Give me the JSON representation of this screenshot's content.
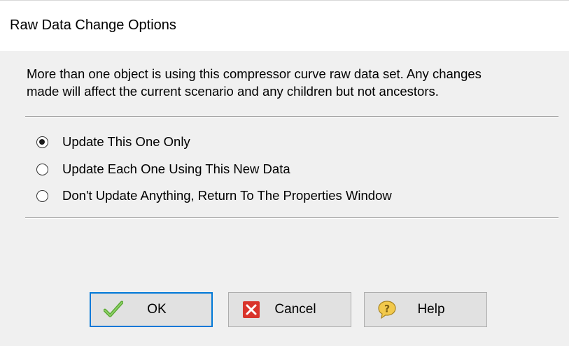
{
  "window": {
    "title": "Raw Data Change Options"
  },
  "description": {
    "line1": "More than one object is using this compressor curve raw data set. Any changes",
    "line2": "made will affect the current scenario and any children but not ancestors."
  },
  "options": [
    {
      "label": "Update This One Only",
      "selected": true
    },
    {
      "label": "Update Each One Using This New Data",
      "selected": false
    },
    {
      "label": "Don't Update Anything, Return To The Properties Window",
      "selected": false
    }
  ],
  "buttons": {
    "ok": {
      "label": "OK",
      "icon": "checkmark-icon",
      "color": "#5aa832"
    },
    "cancel": {
      "label": "Cancel",
      "icon": "close-icon",
      "color": "#d9342b"
    },
    "help": {
      "label": "Help",
      "icon": "help-icon",
      "color": "#f2c94c"
    }
  },
  "colors": {
    "focus_border": "#0078d7"
  }
}
